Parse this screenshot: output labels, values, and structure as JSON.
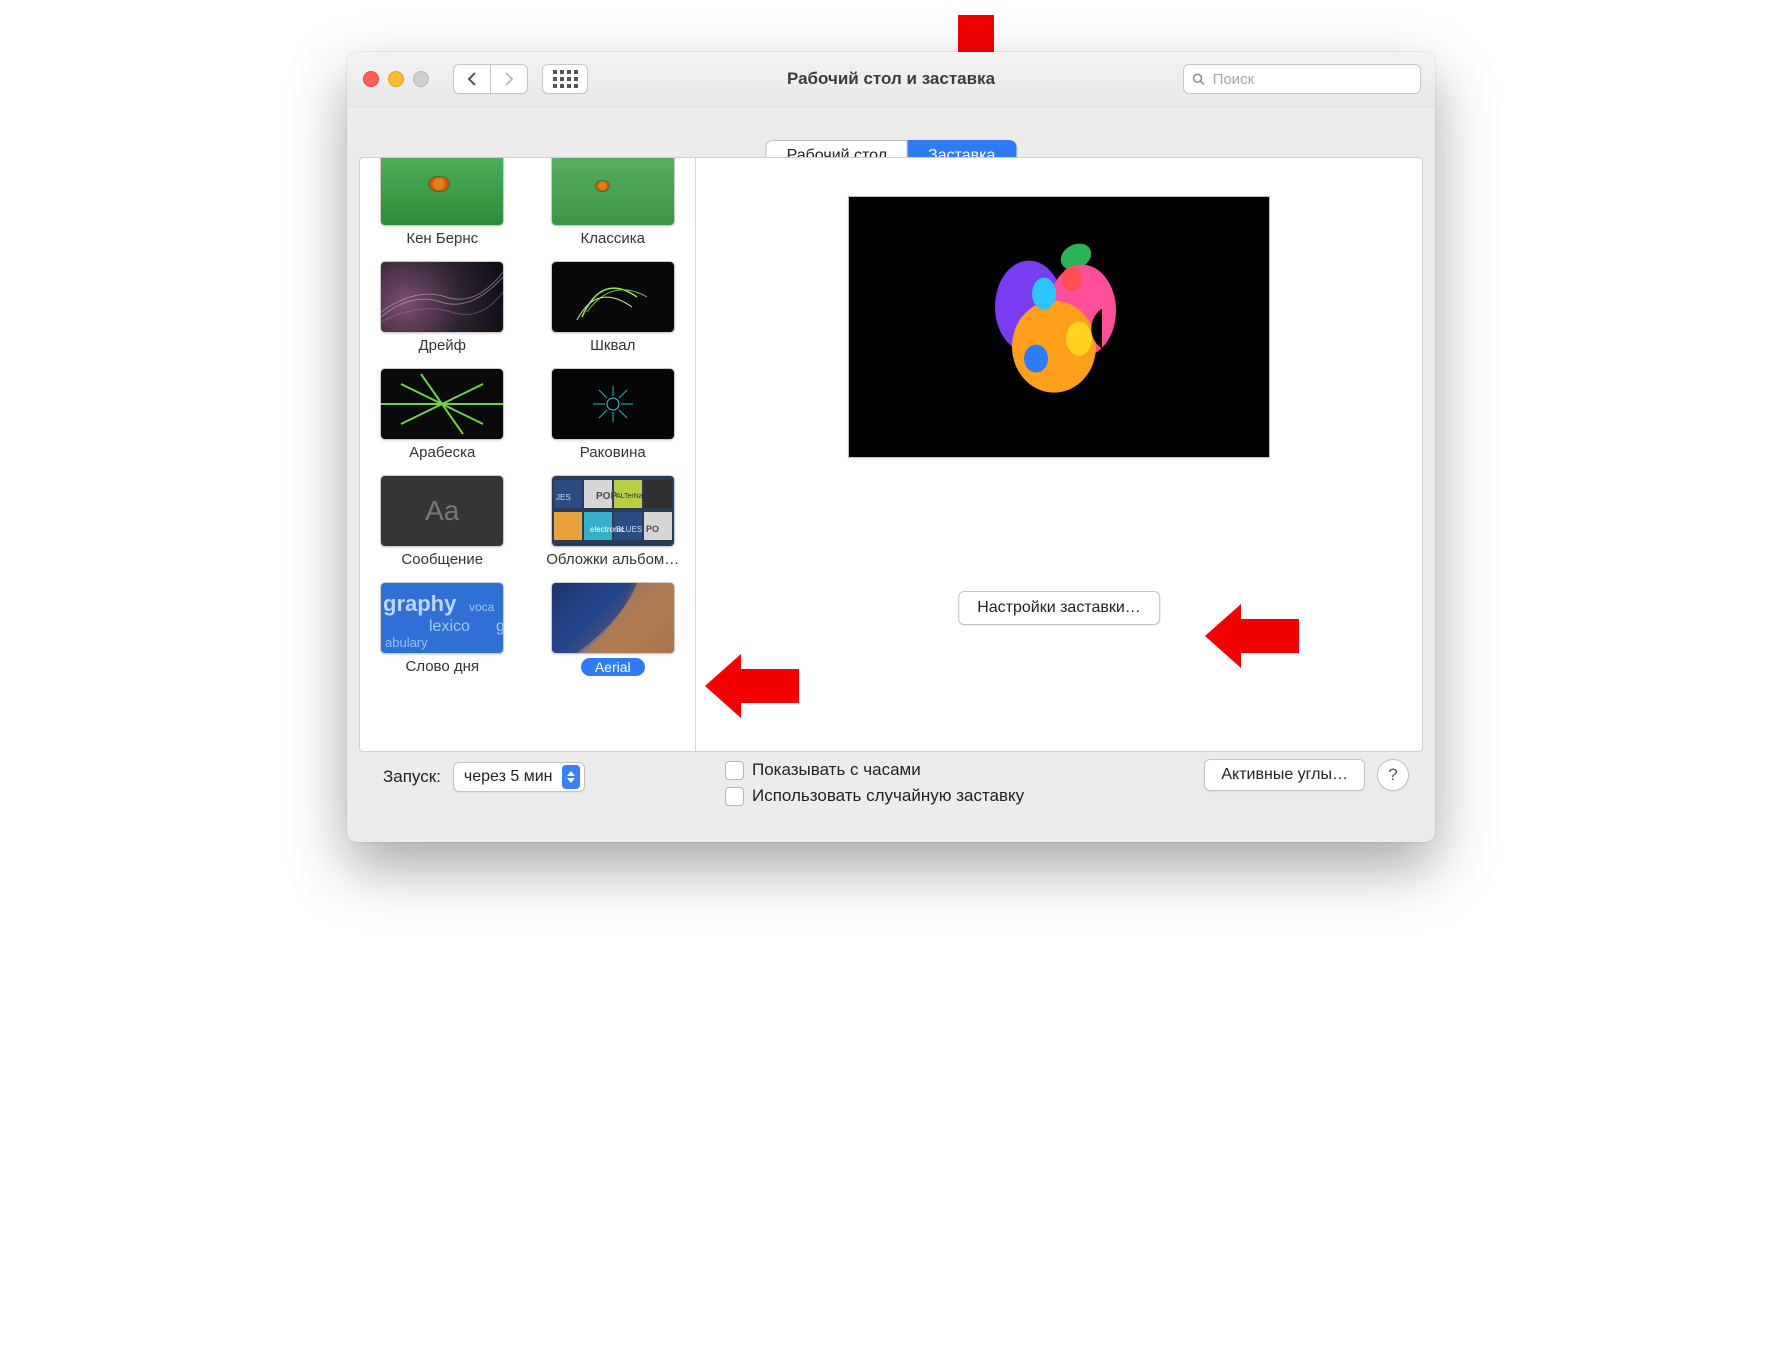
{
  "window": {
    "title": "Рабочий стол и заставка"
  },
  "search": {
    "placeholder": "Поиск"
  },
  "tabs": {
    "desktop": "Рабочий стол",
    "screensaver": "Заставка"
  },
  "savers": {
    "ken_burns": "Кен Бернс",
    "classic": "Классика",
    "drift": "Дрейф",
    "shkval": "Шквал",
    "arabeska": "Арабеска",
    "rakovina": "Раковина",
    "message": "Сообщение",
    "covers": "Обложки альбом…",
    "word": "Слово дня",
    "aerial": "Aerial",
    "msg_sample": "Aa"
  },
  "options_button": "Настройки заставки…",
  "footer": {
    "launch_label": "Запуск:",
    "launch_value": "через 5 мин",
    "show_clock": "Показывать с часами",
    "random": "Использовать случайную заставку",
    "hot_corners": "Активные углы…",
    "help": "?"
  }
}
